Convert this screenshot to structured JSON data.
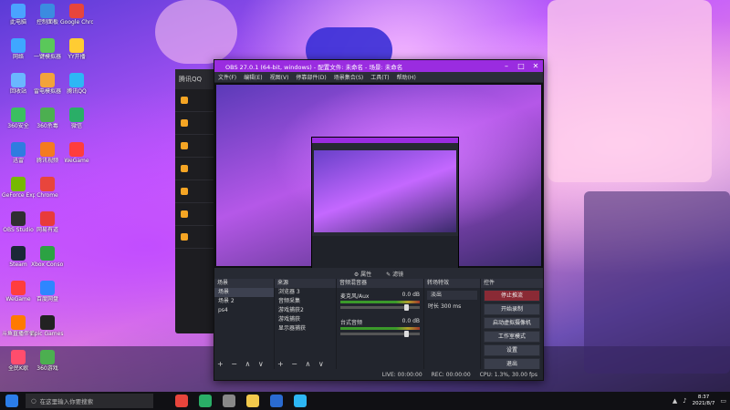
{
  "desktop": {
    "icons": [
      {
        "label": "此电脑",
        "color": "#4aa3ff",
        "col": 0,
        "row": 0
      },
      {
        "label": "控制面板",
        "color": "#3b8be0",
        "col": 1,
        "row": 0
      },
      {
        "label": "Google Chrome",
        "color": "#e8453c",
        "col": 2,
        "row": 0
      },
      {
        "label": "网络",
        "color": "#3fa7ff",
        "col": 0,
        "row": 1
      },
      {
        "label": "一键模拟器",
        "color": "#5ac85a",
        "col": 1,
        "row": 1
      },
      {
        "label": "YY开播",
        "color": "#ffcc33",
        "col": 2,
        "row": 1
      },
      {
        "label": "回收站",
        "color": "#6ab7ff",
        "col": 0,
        "row": 2
      },
      {
        "label": "雷电模拟器",
        "color": "#f2a33a",
        "col": 1,
        "row": 2
      },
      {
        "label": "腾讯QQ",
        "color": "#2db7f5",
        "col": 2,
        "row": 2
      },
      {
        "label": "360安全",
        "color": "#3bbf60",
        "col": 0,
        "row": 3
      },
      {
        "label": "360杀毒",
        "color": "#4caf50",
        "col": 1,
        "row": 3
      },
      {
        "label": "微信",
        "color": "#2aae67",
        "col": 2,
        "row": 3
      },
      {
        "label": "迅雷",
        "color": "#2f7ce0",
        "col": 0,
        "row": 4
      },
      {
        "label": "腾讯视频",
        "color": "#f47b20",
        "col": 1,
        "row": 4
      },
      {
        "label": "WeGame",
        "color": "#ff3d3d",
        "col": 2,
        "row": 4
      },
      {
        "label": "GeForce Experience",
        "color": "#76b900",
        "col": 0,
        "row": 5
      },
      {
        "label": "Chrome",
        "color": "#e8453c",
        "col": 1,
        "row": 5
      },
      {
        "label": "OBS Studio",
        "color": "#302e31",
        "col": 0,
        "row": 6
      },
      {
        "label": "网易有道",
        "color": "#e83b3b",
        "col": 1,
        "row": 6
      },
      {
        "label": "Steam",
        "color": "#1b2838",
        "col": 0,
        "row": 7
      },
      {
        "label": "Xbox Console",
        "color": "#2ca243",
        "col": 1,
        "row": 7
      },
      {
        "label": "WeGame",
        "color": "#ff3d3d",
        "col": 0,
        "row": 8
      },
      {
        "label": "百度网盘",
        "color": "#2f86ff",
        "col": 1,
        "row": 8
      },
      {
        "label": "斗鱼直播伴侣",
        "color": "#ff7a00",
        "col": 0,
        "row": 9
      },
      {
        "label": "Epic Games Launcher",
        "color": "#222222",
        "col": 1,
        "row": 9
      },
      {
        "label": "全民K歌",
        "color": "#ff4d6d",
        "col": 0,
        "row": 10
      },
      {
        "label": "360游戏",
        "color": "#4caf50",
        "col": 1,
        "row": 10
      }
    ]
  },
  "obs": {
    "title": "OBS 27.0.1 (64-bit, windows) - 配置文件: 未命名 - 场景: 未命名",
    "menu": [
      "文件(F)",
      "编辑(E)",
      "视图(V)",
      "停靠部件(D)",
      "场景集合(S)",
      "工具(T)",
      "帮助(H)"
    ],
    "preview_toolbar": {
      "sources_prop": "⚙ 属性",
      "filters": "✎ 滤镜"
    },
    "scenes": {
      "header": "场景",
      "items": [
        "场景",
        "场景 2",
        "ps4"
      ],
      "selected": 0
    },
    "sources": {
      "header": "来源",
      "items": [
        "浏览器 3",
        "音频采集",
        "游戏捕获2",
        "游戏捕获",
        "显示器捕获"
      ]
    },
    "mixer": {
      "header": "音频混音器",
      "channels": [
        {
          "name": "麦克风/Aux",
          "db": "0.0 dB"
        },
        {
          "name": "台式音频",
          "db": "0.0 dB"
        }
      ]
    },
    "transitions": {
      "header": "转场特效",
      "type": "淡出",
      "duration_label": "时长",
      "duration": "300 ms"
    },
    "controls": {
      "header": "控件",
      "buttons": [
        "停止推流",
        "开始录制",
        "启动虚拟摄像机",
        "工作室模式",
        "设置",
        "退出"
      ],
      "active": 0
    },
    "status": {
      "live": "LIVE: 00:00:00",
      "rec": "REC: 00:00:00",
      "cpu": "CPU: 1.3%, 30.00 fps"
    },
    "footer_buttons": "+ − ∧ ∨"
  },
  "taskbar": {
    "search_placeholder": "在这里输入你要搜索",
    "time": "8:37",
    "date": "2021/8/7",
    "apps": [
      {
        "name": "chrome-icon",
        "color": "#e8453c"
      },
      {
        "name": "wechat-icon",
        "color": "#2aae67"
      },
      {
        "name": "obs-icon",
        "color": "#888"
      },
      {
        "name": "explorer-icon",
        "color": "#f2c94c"
      },
      {
        "name": "steam-icon",
        "color": "#2a6bd1"
      },
      {
        "name": "qq-icon",
        "color": "#2db7f5"
      }
    ]
  },
  "qq_panel": {
    "header": "腾讯QQ"
  }
}
